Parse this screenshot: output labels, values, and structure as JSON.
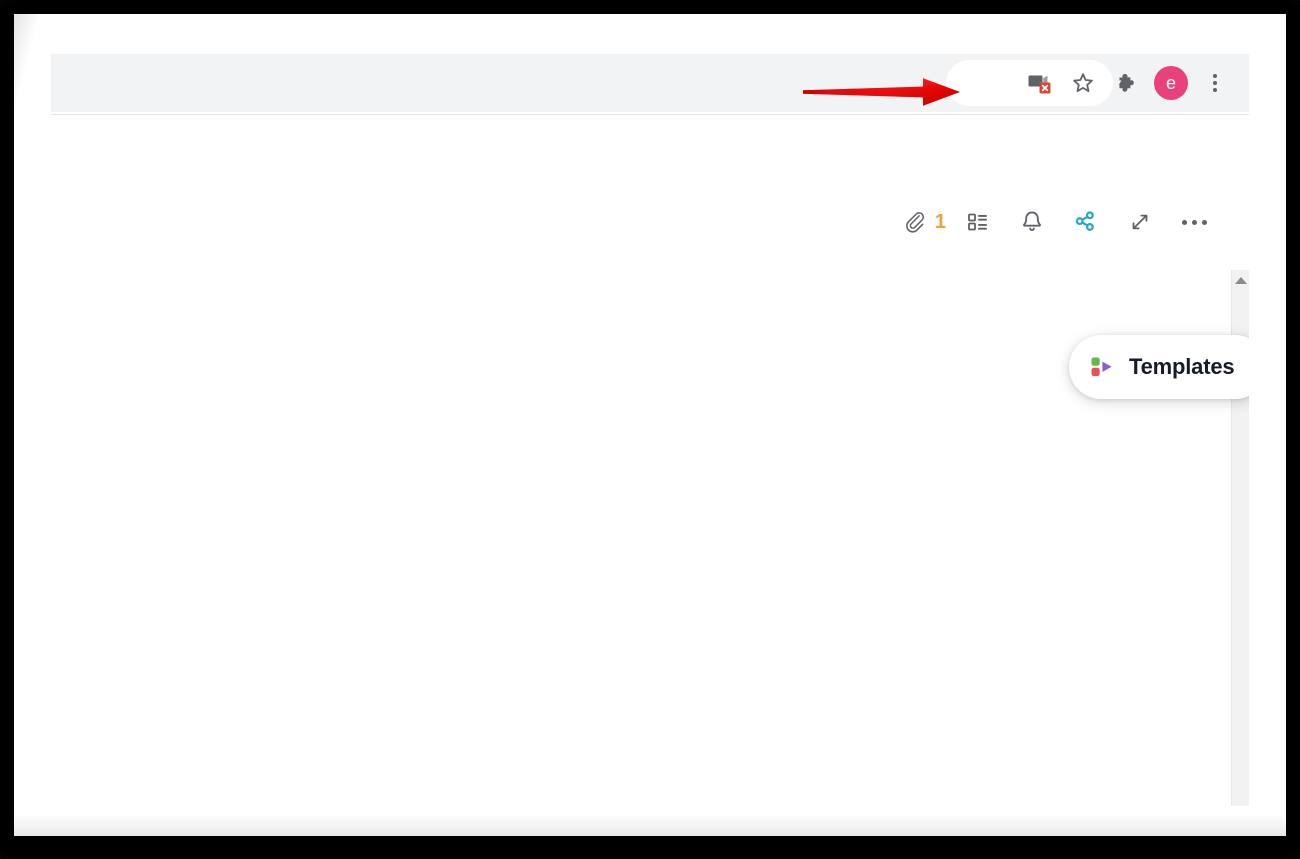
{
  "browser": {
    "toolbar": {
      "actions": [
        {
          "name": "screen-share-stop-icon",
          "label": "Stop sharing screen",
          "badge_color": "#db4437"
        },
        {
          "name": "bookmark-star-icon",
          "label": "Bookmark this tab"
        },
        {
          "name": "extensions-puzzle-icon",
          "label": "Extensions"
        },
        {
          "name": "profile-avatar",
          "label": "e",
          "color": "#e8417e"
        },
        {
          "name": "chrome-menu-kebab-icon",
          "label": "Customize and control Google Chrome"
        }
      ]
    }
  },
  "annotation": {
    "arrow": {
      "name": "red-pointer-arrow",
      "color": "#e00000",
      "direction": "right",
      "points_to": "screen-share-stop-icon"
    }
  },
  "app": {
    "toolbar": {
      "attachments": {
        "icon": "paperclip-icon",
        "count": "1",
        "count_color": "#e8a33d"
      },
      "items": [
        {
          "name": "list-view-icon",
          "label": "Details"
        },
        {
          "name": "bell-notifications-icon",
          "label": "Notifications"
        },
        {
          "name": "share-nodes-icon",
          "label": "Share",
          "color": "#2ba8c8"
        },
        {
          "name": "expand-diagonal-icon",
          "label": "Expand"
        },
        {
          "name": "more-options-icon",
          "label": "More"
        }
      ]
    },
    "tooltip": {
      "name": "templates-tooltip",
      "label": "Templates",
      "icon": "templates-icon",
      "icon_colors": {
        "square_top": "#62bb46",
        "square_bottom": "#e8505b",
        "triangle": "#8e5cd9"
      }
    },
    "scrollbar": {
      "name": "vertical-scrollbar",
      "up_arrow": "scroll-up-arrow"
    }
  }
}
